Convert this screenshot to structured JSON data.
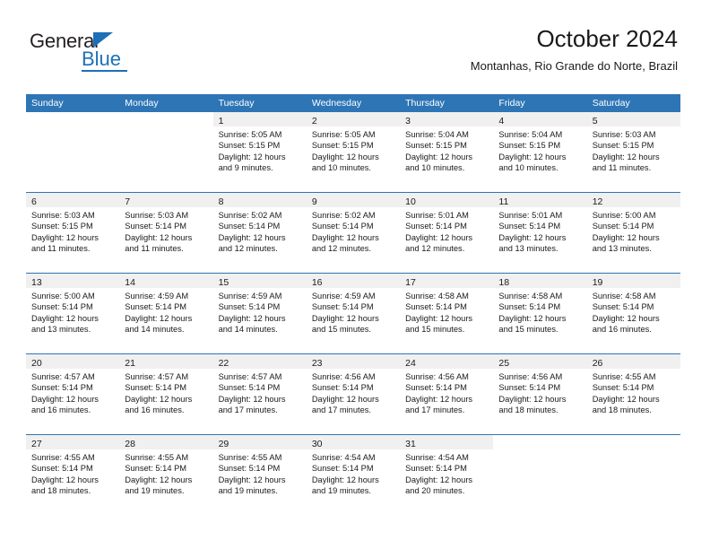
{
  "brand": {
    "name_part1": "General",
    "name_part2": "Blue",
    "accent_color": "#1d70b8"
  },
  "header": {
    "title": "October 2024",
    "subtitle": "Montanhas, Rio Grande do Norte, Brazil"
  },
  "calendar": {
    "header_color": "#2e75b6",
    "weekdays": [
      "Sunday",
      "Monday",
      "Tuesday",
      "Wednesday",
      "Thursday",
      "Friday",
      "Saturday"
    ],
    "weeks": [
      [
        {
          "blank": true
        },
        {
          "blank": true
        },
        {
          "day": "1",
          "sunrise": "Sunrise: 5:05 AM",
          "sunset": "Sunset: 5:15 PM",
          "daylight1": "Daylight: 12 hours",
          "daylight2": "and 9 minutes."
        },
        {
          "day": "2",
          "sunrise": "Sunrise: 5:05 AM",
          "sunset": "Sunset: 5:15 PM",
          "daylight1": "Daylight: 12 hours",
          "daylight2": "and 10 minutes."
        },
        {
          "day": "3",
          "sunrise": "Sunrise: 5:04 AM",
          "sunset": "Sunset: 5:15 PM",
          "daylight1": "Daylight: 12 hours",
          "daylight2": "and 10 minutes."
        },
        {
          "day": "4",
          "sunrise": "Sunrise: 5:04 AM",
          "sunset": "Sunset: 5:15 PM",
          "daylight1": "Daylight: 12 hours",
          "daylight2": "and 10 minutes."
        },
        {
          "day": "5",
          "sunrise": "Sunrise: 5:03 AM",
          "sunset": "Sunset: 5:15 PM",
          "daylight1": "Daylight: 12 hours",
          "daylight2": "and 11 minutes."
        }
      ],
      [
        {
          "day": "6",
          "sunrise": "Sunrise: 5:03 AM",
          "sunset": "Sunset: 5:15 PM",
          "daylight1": "Daylight: 12 hours",
          "daylight2": "and 11 minutes."
        },
        {
          "day": "7",
          "sunrise": "Sunrise: 5:03 AM",
          "sunset": "Sunset: 5:14 PM",
          "daylight1": "Daylight: 12 hours",
          "daylight2": "and 11 minutes."
        },
        {
          "day": "8",
          "sunrise": "Sunrise: 5:02 AM",
          "sunset": "Sunset: 5:14 PM",
          "daylight1": "Daylight: 12 hours",
          "daylight2": "and 12 minutes."
        },
        {
          "day": "9",
          "sunrise": "Sunrise: 5:02 AM",
          "sunset": "Sunset: 5:14 PM",
          "daylight1": "Daylight: 12 hours",
          "daylight2": "and 12 minutes."
        },
        {
          "day": "10",
          "sunrise": "Sunrise: 5:01 AM",
          "sunset": "Sunset: 5:14 PM",
          "daylight1": "Daylight: 12 hours",
          "daylight2": "and 12 minutes."
        },
        {
          "day": "11",
          "sunrise": "Sunrise: 5:01 AM",
          "sunset": "Sunset: 5:14 PM",
          "daylight1": "Daylight: 12 hours",
          "daylight2": "and 13 minutes."
        },
        {
          "day": "12",
          "sunrise": "Sunrise: 5:00 AM",
          "sunset": "Sunset: 5:14 PM",
          "daylight1": "Daylight: 12 hours",
          "daylight2": "and 13 minutes."
        }
      ],
      [
        {
          "day": "13",
          "sunrise": "Sunrise: 5:00 AM",
          "sunset": "Sunset: 5:14 PM",
          "daylight1": "Daylight: 12 hours",
          "daylight2": "and 13 minutes."
        },
        {
          "day": "14",
          "sunrise": "Sunrise: 4:59 AM",
          "sunset": "Sunset: 5:14 PM",
          "daylight1": "Daylight: 12 hours",
          "daylight2": "and 14 minutes."
        },
        {
          "day": "15",
          "sunrise": "Sunrise: 4:59 AM",
          "sunset": "Sunset: 5:14 PM",
          "daylight1": "Daylight: 12 hours",
          "daylight2": "and 14 minutes."
        },
        {
          "day": "16",
          "sunrise": "Sunrise: 4:59 AM",
          "sunset": "Sunset: 5:14 PM",
          "daylight1": "Daylight: 12 hours",
          "daylight2": "and 15 minutes."
        },
        {
          "day": "17",
          "sunrise": "Sunrise: 4:58 AM",
          "sunset": "Sunset: 5:14 PM",
          "daylight1": "Daylight: 12 hours",
          "daylight2": "and 15 minutes."
        },
        {
          "day": "18",
          "sunrise": "Sunrise: 4:58 AM",
          "sunset": "Sunset: 5:14 PM",
          "daylight1": "Daylight: 12 hours",
          "daylight2": "and 15 minutes."
        },
        {
          "day": "19",
          "sunrise": "Sunrise: 4:58 AM",
          "sunset": "Sunset: 5:14 PM",
          "daylight1": "Daylight: 12 hours",
          "daylight2": "and 16 minutes."
        }
      ],
      [
        {
          "day": "20",
          "sunrise": "Sunrise: 4:57 AM",
          "sunset": "Sunset: 5:14 PM",
          "daylight1": "Daylight: 12 hours",
          "daylight2": "and 16 minutes."
        },
        {
          "day": "21",
          "sunrise": "Sunrise: 4:57 AM",
          "sunset": "Sunset: 5:14 PM",
          "daylight1": "Daylight: 12 hours",
          "daylight2": "and 16 minutes."
        },
        {
          "day": "22",
          "sunrise": "Sunrise: 4:57 AM",
          "sunset": "Sunset: 5:14 PM",
          "daylight1": "Daylight: 12 hours",
          "daylight2": "and 17 minutes."
        },
        {
          "day": "23",
          "sunrise": "Sunrise: 4:56 AM",
          "sunset": "Sunset: 5:14 PM",
          "daylight1": "Daylight: 12 hours",
          "daylight2": "and 17 minutes."
        },
        {
          "day": "24",
          "sunrise": "Sunrise: 4:56 AM",
          "sunset": "Sunset: 5:14 PM",
          "daylight1": "Daylight: 12 hours",
          "daylight2": "and 17 minutes."
        },
        {
          "day": "25",
          "sunrise": "Sunrise: 4:56 AM",
          "sunset": "Sunset: 5:14 PM",
          "daylight1": "Daylight: 12 hours",
          "daylight2": "and 18 minutes."
        },
        {
          "day": "26",
          "sunrise": "Sunrise: 4:55 AM",
          "sunset": "Sunset: 5:14 PM",
          "daylight1": "Daylight: 12 hours",
          "daylight2": "and 18 minutes."
        }
      ],
      [
        {
          "day": "27",
          "sunrise": "Sunrise: 4:55 AM",
          "sunset": "Sunset: 5:14 PM",
          "daylight1": "Daylight: 12 hours",
          "daylight2": "and 18 minutes."
        },
        {
          "day": "28",
          "sunrise": "Sunrise: 4:55 AM",
          "sunset": "Sunset: 5:14 PM",
          "daylight1": "Daylight: 12 hours",
          "daylight2": "and 19 minutes."
        },
        {
          "day": "29",
          "sunrise": "Sunrise: 4:55 AM",
          "sunset": "Sunset: 5:14 PM",
          "daylight1": "Daylight: 12 hours",
          "daylight2": "and 19 minutes."
        },
        {
          "day": "30",
          "sunrise": "Sunrise: 4:54 AM",
          "sunset": "Sunset: 5:14 PM",
          "daylight1": "Daylight: 12 hours",
          "daylight2": "and 19 minutes."
        },
        {
          "day": "31",
          "sunrise": "Sunrise: 4:54 AM",
          "sunset": "Sunset: 5:14 PM",
          "daylight1": "Daylight: 12 hours",
          "daylight2": "and 20 minutes."
        },
        {
          "blank": true
        },
        {
          "blank": true
        }
      ]
    ]
  }
}
